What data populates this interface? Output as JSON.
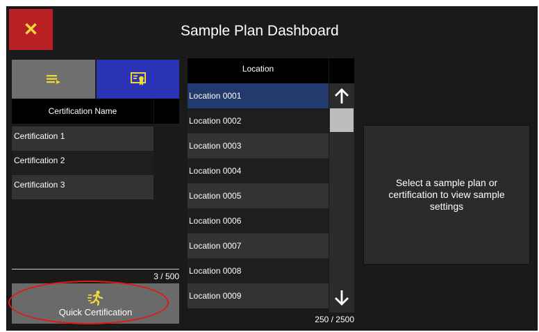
{
  "header": {
    "title": "Sample Plan Dashboard",
    "close_glyph": "✕"
  },
  "left_panel": {
    "toggle_list_icon": "list-icon",
    "toggle_cert_icon": "certificate-icon",
    "column_header": "Certification Name",
    "certifications": [
      "Certification 1",
      "Certification 2",
      "Certification 3"
    ],
    "count": "3 / 500",
    "quick_button": {
      "icon": "running-person-icon",
      "label": "Quick Certification"
    }
  },
  "location_table": {
    "column_header": "Location",
    "rows": [
      "Location 0001",
      "Location 0002",
      "Location 0003",
      "Location 0004",
      "Location 0005",
      "Location 0006",
      "Location 0007",
      "Location 0008",
      "Location 0009"
    ],
    "selected_index": 0,
    "count": "250 / 2500"
  },
  "info_panel": {
    "message": "Select a sample plan or certification to view sample settings"
  },
  "colors": {
    "background": "#1a1a1a",
    "close_button": "#b82025",
    "icon_yellow": "#f3d83a",
    "toggle_active": "#2a33b3",
    "selected_row": "#223a6e",
    "highlight_red": "#e01818"
  }
}
